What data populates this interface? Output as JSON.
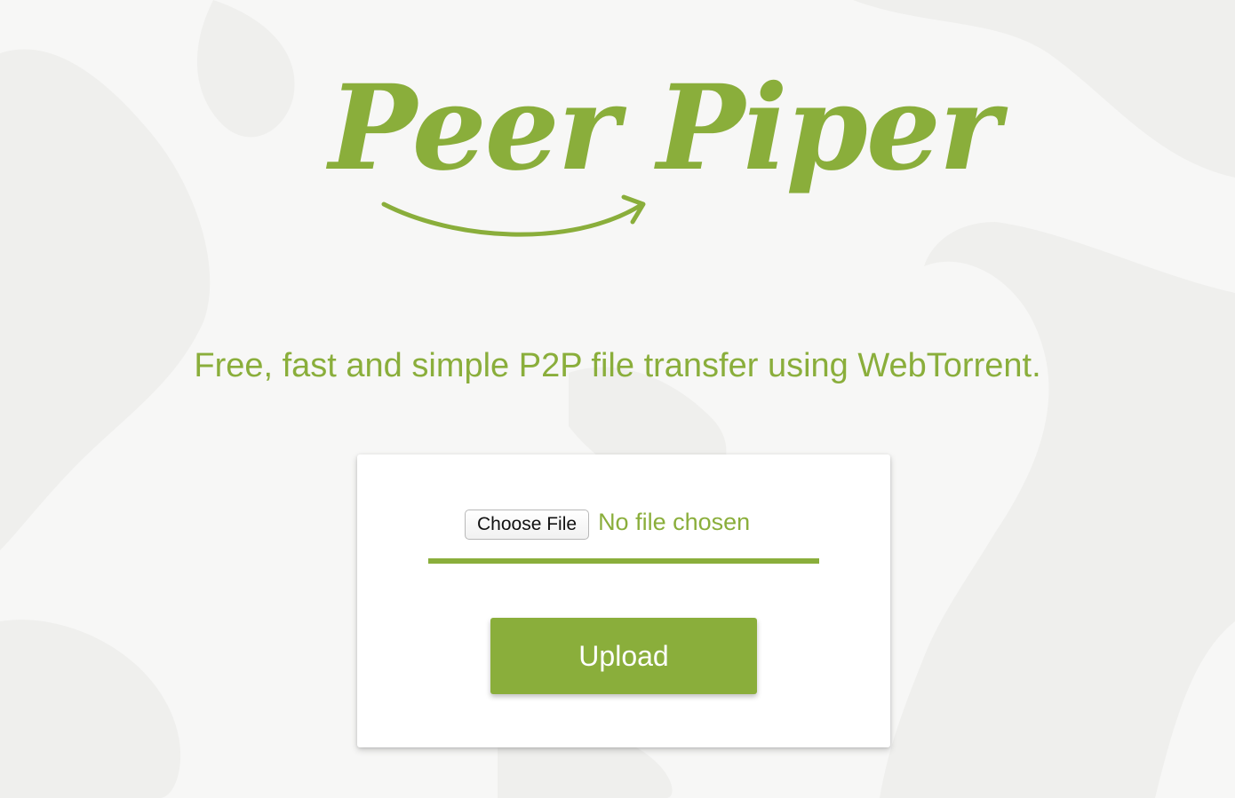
{
  "colors": {
    "brand": "#8aae3b",
    "background": "#f7f7f6",
    "map_land": "#eeeeec"
  },
  "logo": {
    "text": "Peer Piper",
    "icon": "curved-arrow-icon"
  },
  "tagline": "Free, fast and simple P2P file transfer using WebTorrent.",
  "upload_form": {
    "choose_file_label": "Choose File",
    "file_status": "No file chosen",
    "upload_label": "Upload"
  }
}
